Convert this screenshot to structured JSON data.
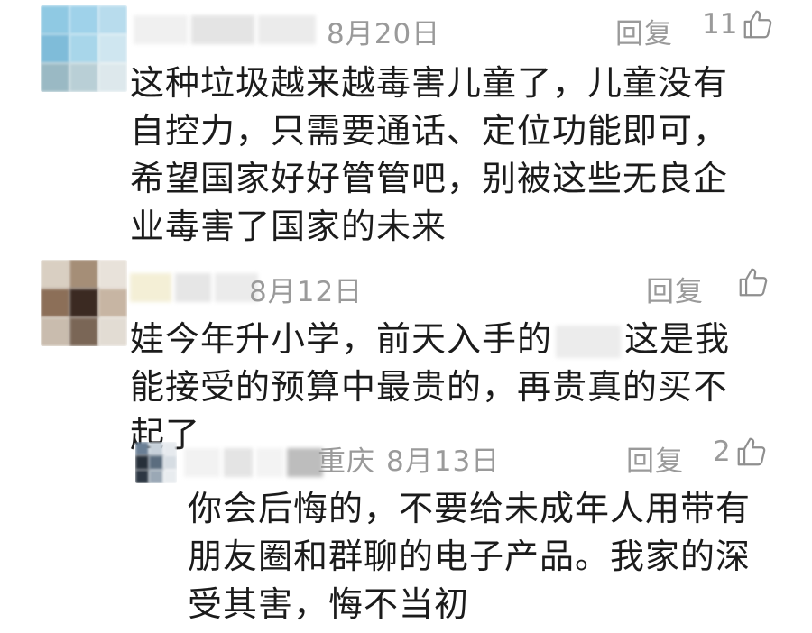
{
  "comments": [
    {
      "date": "8月20日",
      "reply_label": "回复",
      "like_count": "11",
      "text": "这种垃圾越来越毒害儿童了，儿童没有自控力，只需要通话、定位功能即可，希望国家好好管管吧，别被这些无良企业毒害了国家的未来"
    },
    {
      "date": "8月12日",
      "reply_label": "回复",
      "like_count": "",
      "text_before": "娃今年升小学，前天入手的",
      "text_after": "这是我能接受的预算中最贵的，再贵真的买不起了"
    },
    {
      "location": "重庆",
      "date": "8月13日",
      "reply_label": "回复",
      "like_count": "2",
      "text": "你会后悔的，不要给未成年人用带有朋友圈和群聊的电子产品。我家的深受其害，悔不当初"
    }
  ],
  "icons": {
    "like": "thumbs-up-icon"
  }
}
